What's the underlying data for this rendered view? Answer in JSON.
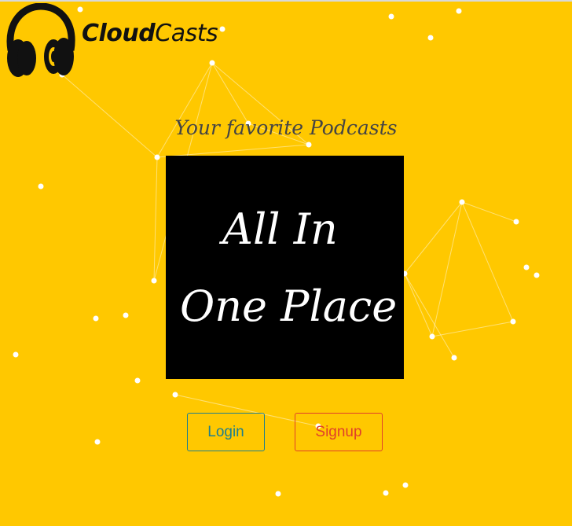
{
  "header": {
    "brand_bold": "Cloud",
    "brand_rest": "Casts",
    "logo_icon": "headphones-icon"
  },
  "hero": {
    "tagline": "Your favorite Podcasts",
    "line1": "All In",
    "line2": "One Place"
  },
  "actions": {
    "login_label": "Login",
    "signup_label": "Signup"
  },
  "colors": {
    "background": "#ffc800",
    "hero": "#000000",
    "login": "#1f7f8c",
    "signup": "#e0402a",
    "particles": "#ffffff"
  }
}
